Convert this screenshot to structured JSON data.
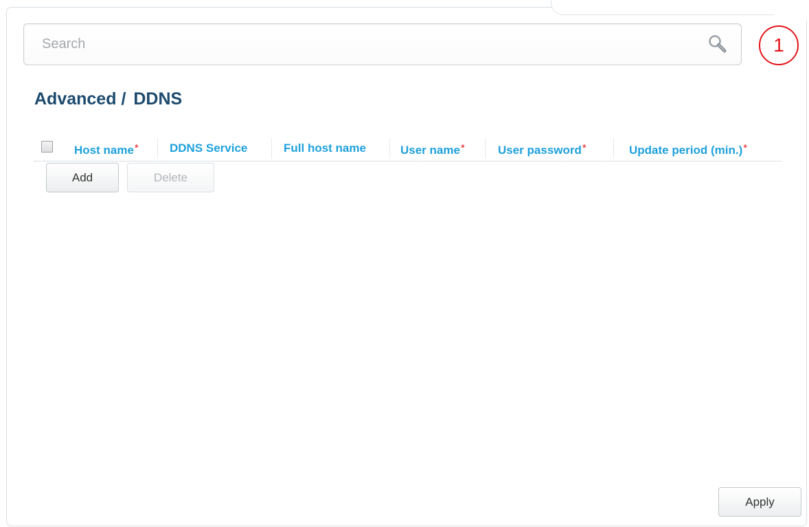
{
  "search": {
    "placeholder": "Search",
    "value": ""
  },
  "notification": {
    "count": "1"
  },
  "breadcrumb": {
    "section": "Advanced",
    "separator": "/",
    "page": "DDNS"
  },
  "table": {
    "columns": [
      {
        "label": "Host name",
        "required": true
      },
      {
        "label": "DDNS Service",
        "required": false
      },
      {
        "label": "Full host name",
        "required": false
      },
      {
        "label": "User name",
        "required": true
      },
      {
        "label": "User password",
        "required": true
      },
      {
        "label": "Update period (min.)",
        "required": true
      }
    ],
    "required_marker": "*",
    "rows": []
  },
  "actions": {
    "add_label": "Add",
    "delete_label": "Delete",
    "apply_label": "Apply"
  },
  "colors": {
    "title": "#1c4a6e",
    "column_header": "#1ea1dc",
    "required_marker": "#e3141b",
    "badge": "#e3141b"
  },
  "icons": {
    "search": "search-icon",
    "badge": "notification-badge"
  }
}
